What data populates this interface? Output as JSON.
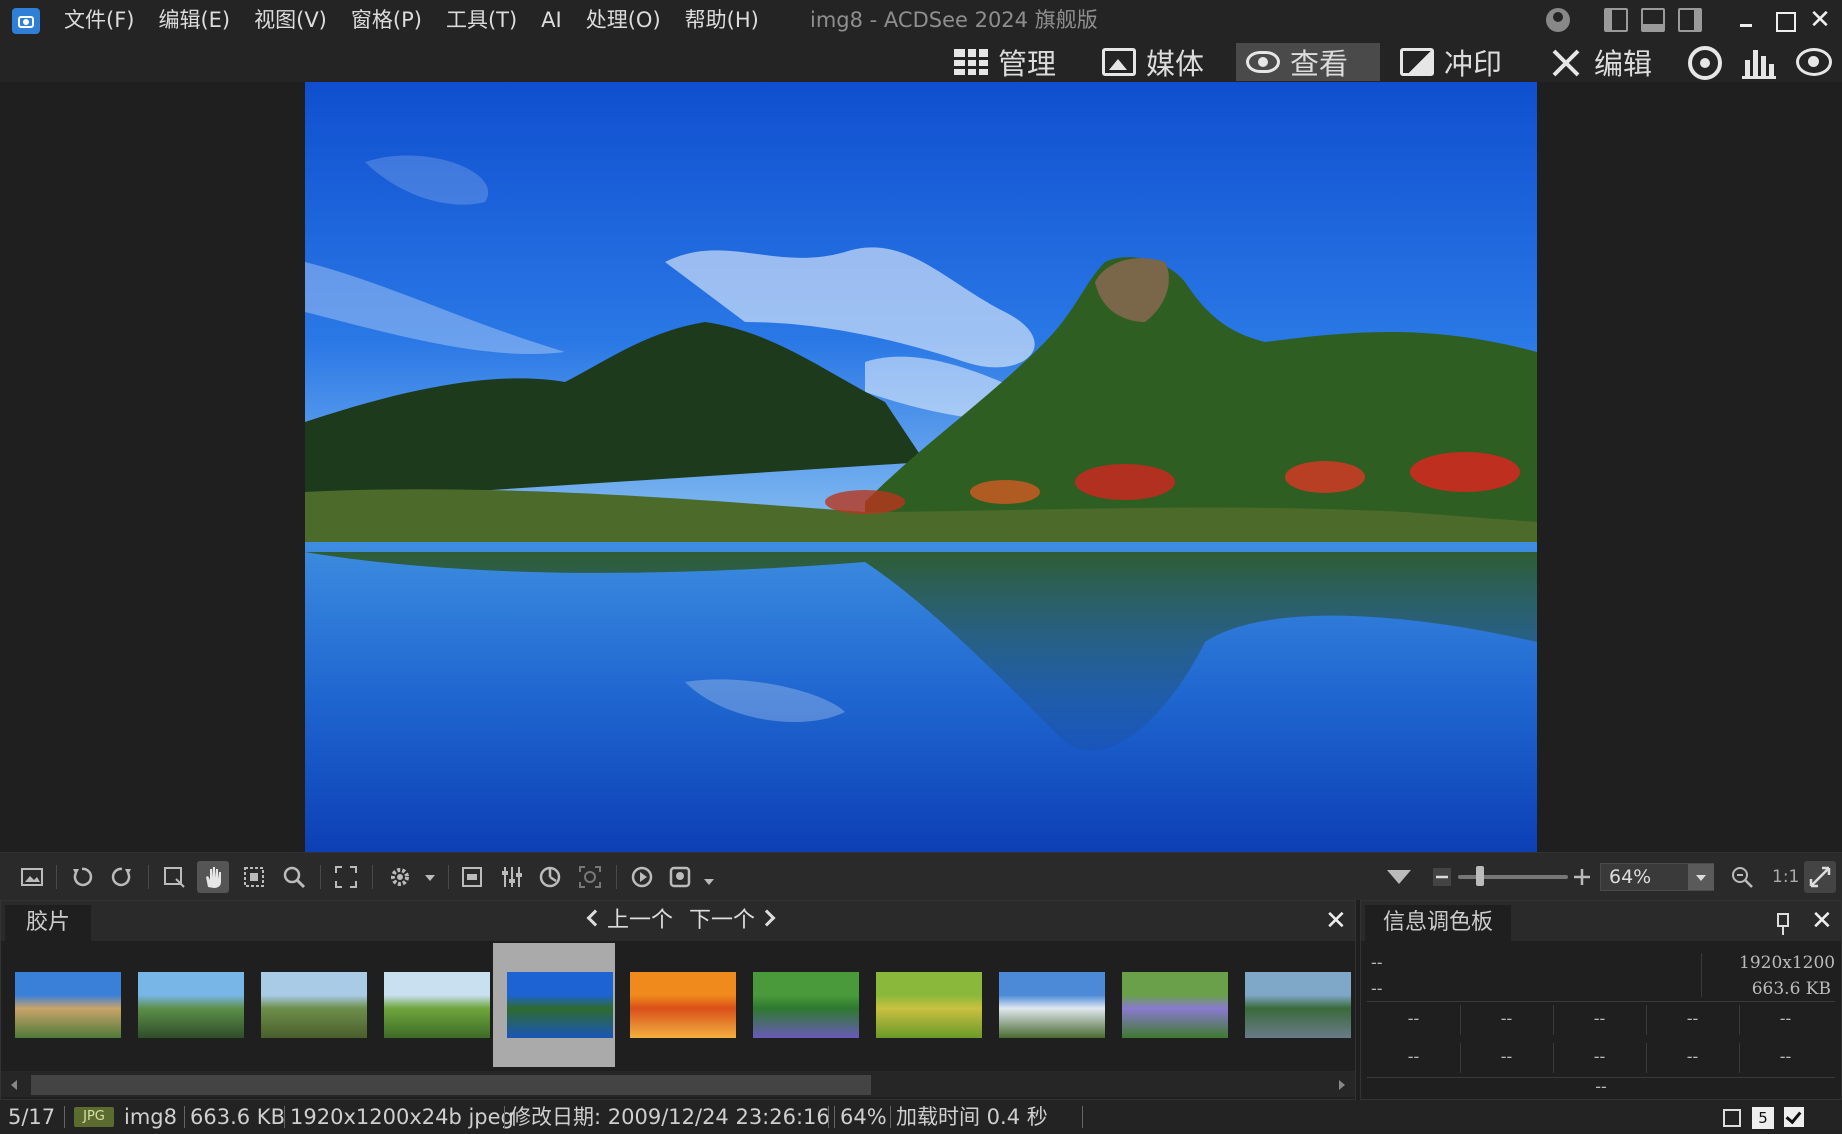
{
  "window": {
    "title": "img8 - ACDSee 2024 旗舰版"
  },
  "menu": [
    "文件(F)",
    "编辑(E)",
    "视图(V)",
    "窗格(P)",
    "工具(T)",
    "AI",
    "处理(O)",
    "帮助(H)"
  ],
  "modes": {
    "manage": "管理",
    "media": "媒体",
    "view": "查看",
    "develop": "冲印",
    "edit": "编辑",
    "active": "view"
  },
  "toolbar": {
    "zoom": "64%",
    "actual_size": "1:1"
  },
  "filmstrip": {
    "tab": "胶片",
    "prev": "上一个",
    "next": "下一个",
    "selected_index": 4,
    "thumbnails": [
      {
        "name": "town-river",
        "colors": [
          "#3a7fd8",
          "#c9a46a",
          "#4f7a3a"
        ]
      },
      {
        "name": "lake-valley",
        "colors": [
          "#79b6e8",
          "#5d8f4a",
          "#2f4d2a"
        ]
      },
      {
        "name": "hills-fence",
        "colors": [
          "#a9cbe6",
          "#6e8e4b",
          "#4a5e2c"
        ]
      },
      {
        "name": "green-stream",
        "colors": [
          "#c8e0f0",
          "#6fa53c",
          "#3e6b27"
        ]
      },
      {
        "name": "img8-lake",
        "colors": [
          "#1d63d3",
          "#2e6b2e",
          "#1a55b8"
        ]
      },
      {
        "name": "autumn-leaves",
        "colors": [
          "#f08a1c",
          "#d9501a",
          "#f3b040"
        ]
      },
      {
        "name": "purple-flowers-green",
        "colors": [
          "#4a9a3c",
          "#2d7a2e",
          "#6a5ab8"
        ]
      },
      {
        "name": "yellow-leaves",
        "colors": [
          "#8ab83a",
          "#c9c040",
          "#6a9a2a"
        ]
      },
      {
        "name": "field-sky",
        "colors": [
          "#4c8ad8",
          "#e0e8f0",
          "#4a6a30"
        ]
      },
      {
        "name": "lavender-flowers",
        "colors": [
          "#6aa04a",
          "#8a7ad0",
          "#3e7a30"
        ]
      },
      {
        "name": "bridge-lake",
        "colors": [
          "#7fa8c8",
          "#3a6a3a",
          "#6a7a8a"
        ]
      }
    ]
  },
  "info_palette": {
    "tab": "信息调色板",
    "dims": "1920x1200",
    "size": "663.6 KB",
    "placeholder": "--"
  },
  "status": {
    "position": "5/17",
    "format": "JPG",
    "filename": "img8",
    "filesize": "663.6 KB",
    "dimensions": "1920x1200x24b jpeg",
    "modified": "修改日期: 2009/12/24 23:26:16",
    "zoom": "64%",
    "load_time": "加载时间 0.4 秒",
    "count_badge": "5"
  }
}
